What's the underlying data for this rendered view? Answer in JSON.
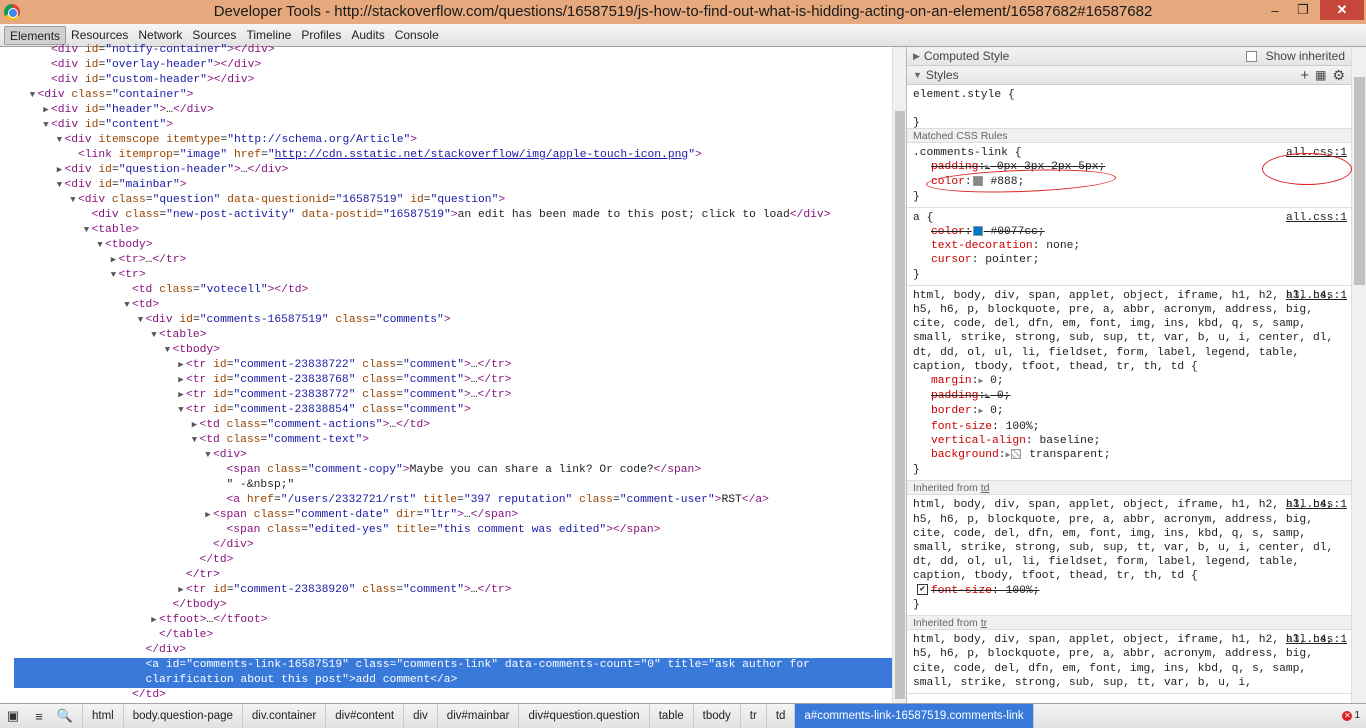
{
  "window": {
    "title": "Developer Tools - http://stackoverflow.com/questions/16587519/js-how-to-find-out-what-is-hidding-acting-on-an-element/16587682#16587682",
    "controls": {
      "minimize": "–",
      "maximize": "❐",
      "close": "✕"
    }
  },
  "tabs": [
    {
      "label": "Elements",
      "active": true
    },
    {
      "label": "Resources"
    },
    {
      "label": "Network"
    },
    {
      "label": "Sources"
    },
    {
      "label": "Timeline"
    },
    {
      "label": "Profiles"
    },
    {
      "label": "Audits"
    },
    {
      "label": "Console"
    }
  ],
  "dom_lines": [
    {
      "indent": 2,
      "tri": "",
      "html": "<div id=\"notify-container\"></div>"
    },
    {
      "indent": 2,
      "tri": "",
      "html": "<div id=\"overlay-header\"></div>"
    },
    {
      "indent": 2,
      "tri": "",
      "html": "<div id=\"custom-header\"></div>"
    },
    {
      "indent": 1,
      "tri": "down",
      "html": "<div class=\"container\">"
    },
    {
      "indent": 2,
      "tri": "right",
      "html": "<div id=\"header\">…</div>"
    },
    {
      "indent": 2,
      "tri": "down",
      "html": "<div id=\"content\">"
    },
    {
      "indent": 3,
      "tri": "down",
      "html": "<div itemscope itemtype=\"http://schema.org/Article\">"
    },
    {
      "indent": 4,
      "tri": "",
      "html": "<link itemprop=\"image\" href=\"http://cdn.sstatic.net/stackoverflow/img/apple-touch-icon.png\">",
      "link": "http://cdn.sstatic.net/stackoverflow/img/apple-touch-icon.png"
    },
    {
      "indent": 3,
      "tri": "right",
      "html": "<div id=\"question-header\">…</div>"
    },
    {
      "indent": 3,
      "tri": "down",
      "html": "<div id=\"mainbar\">"
    },
    {
      "indent": 4,
      "tri": "down",
      "html": "<div class=\"question\" data-questionid=\"16587519\" id=\"question\">"
    },
    {
      "indent": 5,
      "tri": "",
      "html": "<div class=\"new-post-activity\" data-postid=\"16587519\">an edit has been made to this post; click to load</div>"
    },
    {
      "indent": 5,
      "tri": "down",
      "html": "<table>"
    },
    {
      "indent": 6,
      "tri": "down",
      "html": "<tbody>"
    },
    {
      "indent": 7,
      "tri": "right",
      "html": "<tr>…</tr>"
    },
    {
      "indent": 7,
      "tri": "down",
      "html": "<tr>"
    },
    {
      "indent": 8,
      "tri": "",
      "html": "<td class=\"votecell\"></td>"
    },
    {
      "indent": 8,
      "tri": "down",
      "html": "<td>"
    },
    {
      "indent": 9,
      "tri": "down",
      "html": "<div id=\"comments-16587519\" class=\"comments\">"
    },
    {
      "indent": 10,
      "tri": "down",
      "html": "<table>"
    },
    {
      "indent": 11,
      "tri": "down",
      "html": "<tbody>"
    },
    {
      "indent": 12,
      "tri": "right",
      "html": "<tr id=\"comment-23838722\" class=\"comment\">…</tr>"
    },
    {
      "indent": 12,
      "tri": "right",
      "html": "<tr id=\"comment-23838768\" class=\"comment\">…</tr>"
    },
    {
      "indent": 12,
      "tri": "right",
      "html": "<tr id=\"comment-23838772\" class=\"comment\">…</tr>"
    },
    {
      "indent": 12,
      "tri": "down",
      "html": "<tr id=\"comment-23838854\" class=\"comment\">"
    },
    {
      "indent": 13,
      "tri": "right",
      "html": "<td class=\"comment-actions\">…</td>"
    },
    {
      "indent": 13,
      "tri": "down",
      "html": "<td class=\"comment-text\">"
    },
    {
      "indent": 14,
      "tri": "down",
      "html": "<div>"
    },
    {
      "indent": 15,
      "tri": "",
      "html": "<span class=\"comment-copy\">Maybe you can share a link? Or code?</span>"
    },
    {
      "indent": 15,
      "tri": "",
      "text": "\" -&nbsp;\""
    },
    {
      "indent": 15,
      "tri": "",
      "html": "<a href=\"/users/2332721/rst\" title=\"397 reputation\" class=\"comment-user\">RST</a>"
    },
    {
      "indent": 14,
      "tri": "right",
      "html": "<span class=\"comment-date\" dir=\"ltr\">…</span>"
    },
    {
      "indent": 15,
      "tri": "",
      "html": "<span class=\"edited-yes\" title=\"this comment was edited\"></span>"
    },
    {
      "indent": 14,
      "tri": "",
      "html": "</div>"
    },
    {
      "indent": 13,
      "tri": "",
      "html": "</td>"
    },
    {
      "indent": 12,
      "tri": "",
      "html": "</tr>"
    },
    {
      "indent": 12,
      "tri": "right",
      "html": "<tr id=\"comment-23838920\" class=\"comment\">…</tr>"
    },
    {
      "indent": 11,
      "tri": "",
      "html": "</tbody>"
    },
    {
      "indent": 10,
      "tri": "right",
      "html": "<tfoot>…</tfoot>"
    },
    {
      "indent": 10,
      "tri": "",
      "html": "</table>"
    },
    {
      "indent": 9,
      "tri": "",
      "html": "</div>"
    },
    {
      "indent": 9,
      "tri": "",
      "selected": true,
      "html": "<a id=\"comments-link-16587519\" class=\"comments-link\" data-comments-count=\"0\" title=\"ask author for"
    },
    {
      "indent": 9,
      "tri": "",
      "selected": true,
      "text": "clarification about this post\">add comment</a>"
    },
    {
      "indent": 8,
      "tri": "",
      "html": "</td>"
    }
  ],
  "sidebar": {
    "computed_style": {
      "label": "Computed Style",
      "show_inherited_label": "Show inherited"
    },
    "styles": {
      "label": "Styles",
      "icons": [
        "plus-icon",
        "element-state-icon",
        "gear-icon"
      ]
    },
    "element_style": {
      "selector": "element.style {",
      "close": "}"
    },
    "matched_label": "Matched CSS Rules",
    "rules": [
      {
        "selector": ".comments-link {",
        "source": "all.css:1",
        "props": [
          {
            "name": "padding",
            "value": "0px 3px 2px 5px;",
            "expand": true,
            "overridden": true
          },
          {
            "name": "color",
            "value": "#888;",
            "swatch": "#888888"
          }
        ]
      },
      {
        "selector": "a {",
        "source": "all.css:1",
        "props": [
          {
            "name": "color",
            "value": "#0077cc;",
            "swatch": "#0077cc",
            "overridden": true
          },
          {
            "name": "text-decoration",
            "value": "none;"
          },
          {
            "name": "cursor",
            "value": "pointer;"
          }
        ]
      },
      {
        "selector": "html, body, div, span, applet, object, iframe, h1, h2, h3, h4, h5, h6, p, blockquote, pre, a, abbr, acronym, address, big, cite, code, del, dfn, em, font, img, ins, kbd, q, s, samp, small, strike, strong, sub, sup, tt, var, b, u, i, center, dl, dt, dd, ol, ul, li, fieldset, form, label, legend, table, caption, tbody, tfoot, thead, tr, th, td {",
        "source": "all.css:1",
        "props": [
          {
            "name": "margin",
            "value": "0;",
            "expand": true
          },
          {
            "name": "padding",
            "value": "0;",
            "expand": true,
            "overridden": true
          },
          {
            "name": "border",
            "value": "0;",
            "expand": true
          },
          {
            "name": "font-size",
            "value": "100%;"
          },
          {
            "name": "vertical-align",
            "value": "baseline;"
          },
          {
            "name": "background",
            "value": "transparent;",
            "expand": true,
            "swatch": "transparent"
          }
        ]
      }
    ],
    "inherited": [
      {
        "label": "Inherited from",
        "from": "td",
        "selector": "html, body, div, span, applet, object, iframe, h1, h2, h3, h4, h5, h6, p, blockquote, pre, a, abbr, acronym, address, big, cite, code, del, dfn, em, font, img, ins, kbd, q, s, samp, small, strike, strong, sub, sup, tt, var, b, u, i, center, dl, dt, dd, ol, ul, li, fieldset, form, label, legend, table, caption, tbody, tfoot, thead, tr, th, td {",
        "source": "all.css:1",
        "props": [
          {
            "name": "font-size",
            "value": "100%;",
            "overridden": true,
            "checked": true
          }
        ]
      },
      {
        "label": "Inherited from",
        "from": "tr",
        "selector": "html, body, div, span, applet, object, iframe, h1, h2, h3, h4, h5, h6, p, blockquote, pre, a, abbr, acronym, address, big, cite, code, del, dfn, em, font, img, ins, kbd, q, s, samp, small, strike, strong, sub, sup, tt, var, b, u, i,",
        "source": "all.css:1",
        "props": []
      }
    ]
  },
  "statusbar": {
    "crumbs": [
      "html",
      "body.question-page",
      "div.container",
      "div#content",
      "div",
      "div#mainbar",
      "div#question.question",
      "table",
      "tbody",
      "tr",
      "td",
      "a#comments-link-16587519.comments-link"
    ],
    "active_crumb": 11,
    "error_count": "1"
  }
}
